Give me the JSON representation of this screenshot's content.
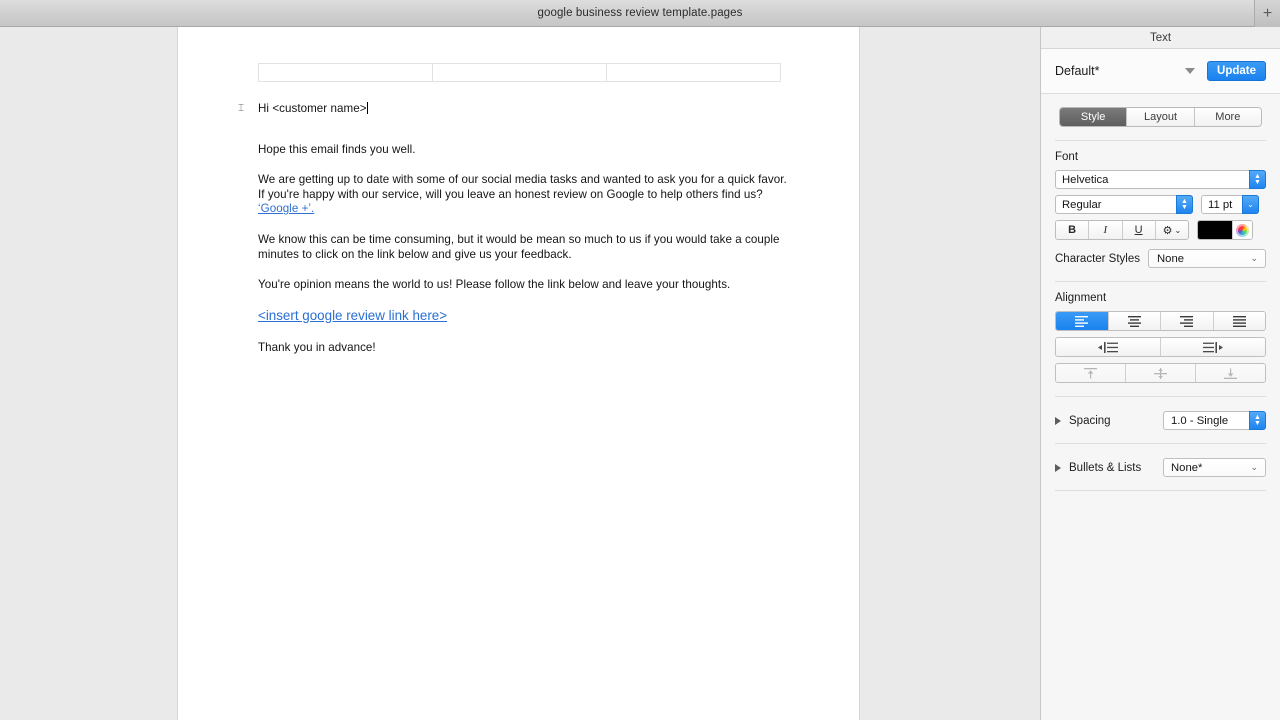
{
  "window": {
    "title": "google business review template.pages",
    "add_button": "+"
  },
  "document": {
    "table": {
      "cells": [
        "",
        "",
        ""
      ]
    },
    "line_marker": "⌶",
    "paragraphs": [
      {
        "id": "greeting",
        "text": "Hi <customer name>"
      },
      {
        "id": "opening",
        "text": "Hope this email finds you well."
      },
      {
        "id": "request_a",
        "text": "We are getting up to date with some of our social media tasks and wanted to ask you for a quick favor.  If you're happy with our service, will you leave an honest review on Google to help others find us? "
      },
      {
        "id": "request_link",
        "text": "‘Google +’."
      },
      {
        "id": "consuming",
        "text": "We know this can be time consuming, but it would be mean so much to us if you would take a couple minutes to click on the link below and give us your feedback."
      },
      {
        "id": "opinion",
        "text": "You're opinion means the world to us!  Please follow the link below and leave your thoughts."
      },
      {
        "id": "review_link",
        "text": "<insert google review link here>"
      },
      {
        "id": "closing",
        "text": "Thank you in advance!"
      }
    ]
  },
  "sidebar": {
    "header": "Text",
    "style": {
      "name": "Default*",
      "update_label": "Update"
    },
    "tabs": [
      {
        "label": "Style",
        "active": true
      },
      {
        "label": "Layout",
        "active": false
      },
      {
        "label": "More",
        "active": false
      }
    ],
    "font": {
      "label": "Font",
      "family": "Helvetica",
      "weight": "Regular",
      "size": "11 pt",
      "bold_label": "B",
      "italic_label": "I",
      "underline_label": "U",
      "gear_label": "⚙",
      "color": "#000000",
      "character_styles_label": "Character Styles",
      "character_styles_value": "None"
    },
    "alignment": {
      "label": "Alignment",
      "buttons": [
        {
          "name": "align-left",
          "active": true
        },
        {
          "name": "align-center",
          "active": false
        },
        {
          "name": "align-right",
          "active": false
        },
        {
          "name": "align-justify",
          "active": false
        }
      ],
      "indent": [
        {
          "name": "decrease-indent"
        },
        {
          "name": "increase-indent"
        }
      ],
      "vertical": [
        {
          "name": "align-top"
        },
        {
          "name": "align-middle"
        },
        {
          "name": "align-bottom"
        }
      ]
    },
    "spacing": {
      "label": "Spacing",
      "value": "1.0 - Single"
    },
    "bullets": {
      "label": "Bullets & Lists",
      "value": "None*"
    }
  },
  "colors": {
    "accent_blue": "#1a82ef",
    "link_blue": "#2a6fd4",
    "tab_active": "#5f5f5f",
    "canvas": "#eaeaea"
  }
}
